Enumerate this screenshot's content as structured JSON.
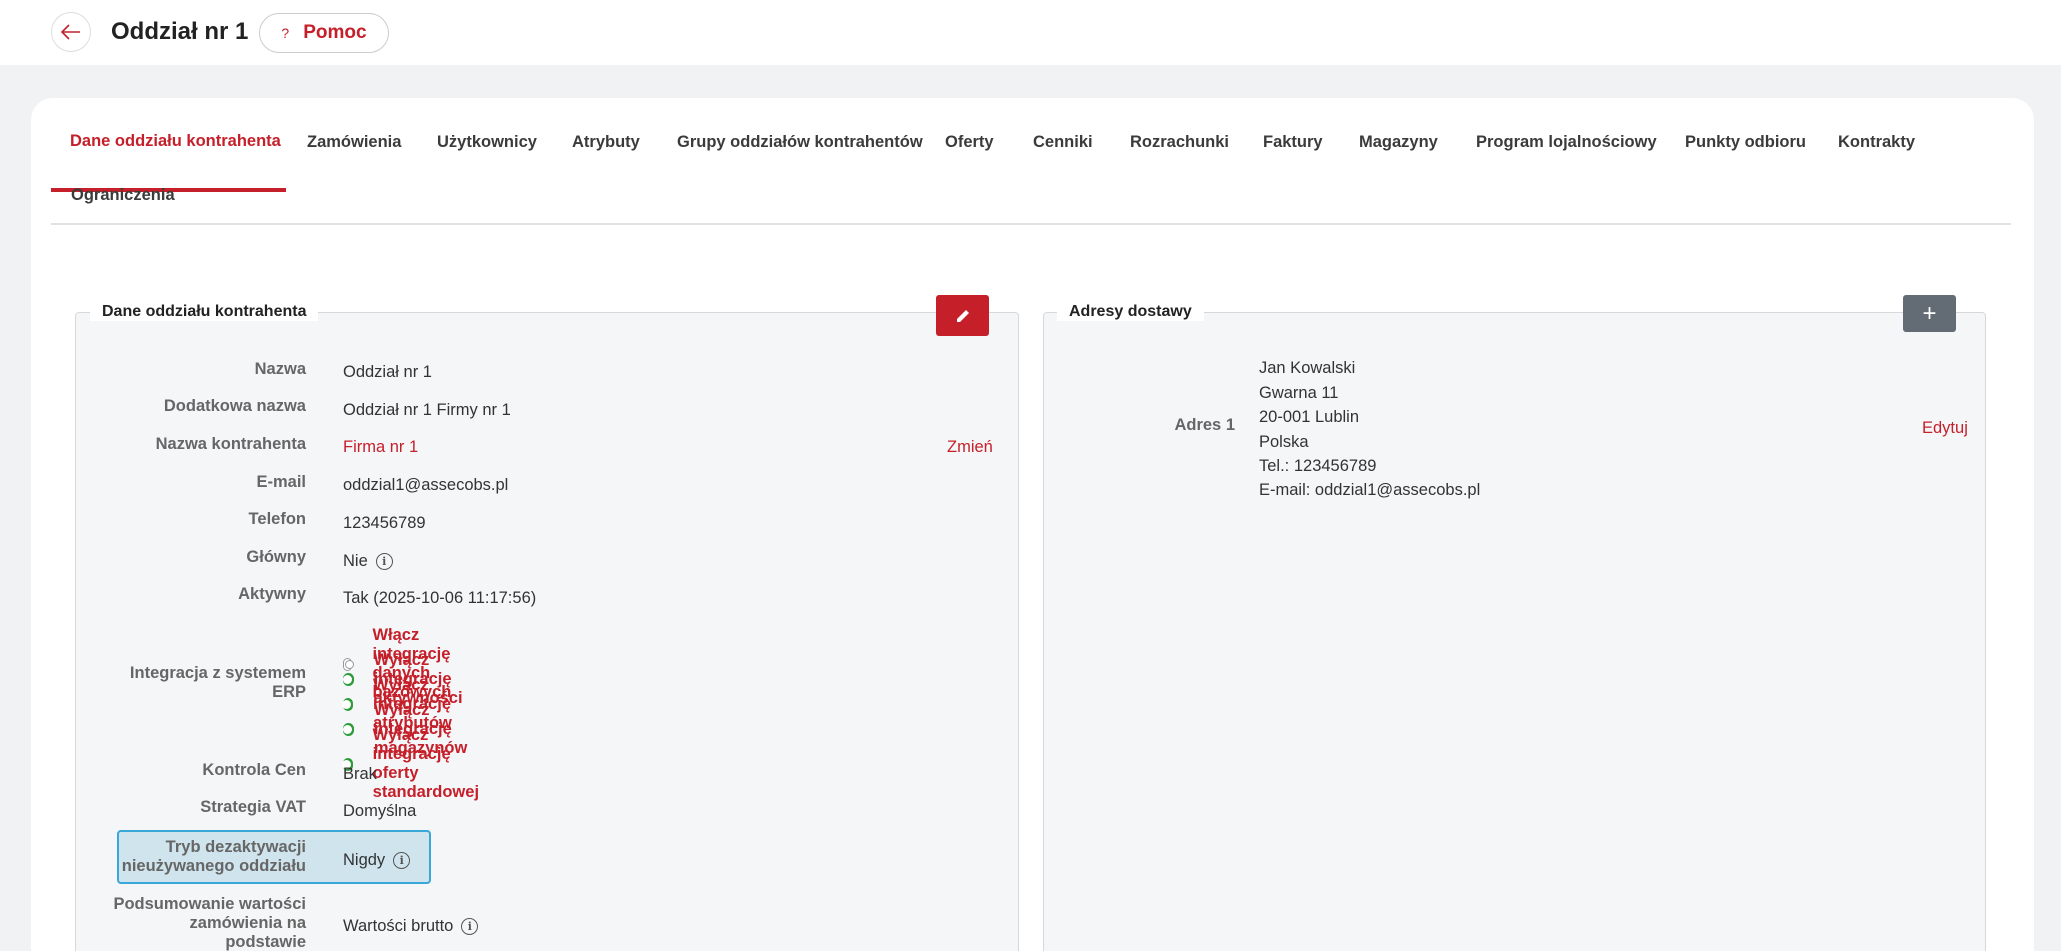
{
  "header": {
    "title": "Oddział nr 1",
    "help_label": "Pomoc",
    "help_icon": "?"
  },
  "tabs": [
    {
      "label": "Dane oddziału kontrahenta",
      "active": true
    },
    {
      "label": "Zamówienia"
    },
    {
      "label": "Użytkownicy"
    },
    {
      "label": "Atrybuty"
    },
    {
      "label": "Grupy oddziałów kontrahentów"
    },
    {
      "label": "Oferty"
    },
    {
      "label": "Cenniki"
    },
    {
      "label": "Rozrachunki"
    },
    {
      "label": "Faktury"
    },
    {
      "label": "Magazyny"
    },
    {
      "label": "Program lojalnościowy"
    },
    {
      "label": "Punkty odbioru"
    },
    {
      "label": "Kontrakty"
    },
    {
      "label": "Ograniczenia"
    }
  ],
  "details": {
    "legend": "Dane oddziału kontrahenta",
    "fields": {
      "nazwa": {
        "label": "Nazwa",
        "value": "Oddział nr 1"
      },
      "dodatkowa": {
        "label": "Dodatkowa nazwa",
        "value": "Oddział nr 1 Firmy nr 1"
      },
      "kontrahent": {
        "label": "Nazwa kontrahenta",
        "value": "Firma nr 1",
        "action": "Zmień"
      },
      "email": {
        "label": "E-mail",
        "value": "oddzial1@assecobs.pl"
      },
      "telefon": {
        "label": "Telefon",
        "value": "123456789"
      },
      "glowny": {
        "label": "Główny",
        "value": "Nie"
      },
      "aktywny": {
        "label": "Aktywny",
        "value": "Tak (2025-10-06 11:17:56)"
      },
      "erp": {
        "label_line1": "Integracja z systemem",
        "label_line2": "ERP"
      },
      "kontrola": {
        "label": "Kontrola Cen",
        "value": "Brak"
      },
      "vat": {
        "label": "Strategia VAT",
        "value": "Domyślna"
      },
      "tryb": {
        "label_line1": "Tryb dezaktywacji",
        "label_line2": "nieużywanego oddziału",
        "value": "Nigdy"
      },
      "podsumowanie": {
        "label_line1": "Podsumowanie wartości",
        "label_line2": "zamówienia na",
        "label_line3": "podstawie",
        "value": "Wartości brutto"
      }
    },
    "toggles": [
      {
        "label": "Włącz integrację danych bazowych",
        "on": false
      },
      {
        "label": "Wyłącz integrację aktywności",
        "on": true
      },
      {
        "label": "Wyłącz integrację atrybutów",
        "on": true
      },
      {
        "label": "Wyłącz integrację magazynów",
        "on": true
      },
      {
        "label": "Wyłącz integrację oferty standardowej",
        "on": true
      }
    ]
  },
  "addresses": {
    "legend": "Adresy dostawy",
    "add_label": "+",
    "items": [
      {
        "label": "Adres 1",
        "action": "Edytuj",
        "lines": [
          "Jan Kowalski",
          "Gwarna 11",
          "20-001 Lublin",
          "Polska",
          "Tel.: 123456789",
          "E-mail: oddzial1@assecobs.pl"
        ]
      }
    ]
  },
  "colors": {
    "accent": "#c51f2a",
    "toggle_on": "#2e9c3a",
    "highlight": "#3aa7d9"
  }
}
